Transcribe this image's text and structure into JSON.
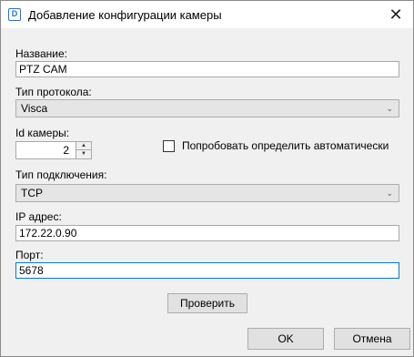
{
  "window": {
    "title": "Добавление конфигурации камеры",
    "app_icon_letter": "D",
    "close_glyph": "✕"
  },
  "form": {
    "name_label": "Название:",
    "name_value": "PTZ CAM",
    "protocol_label": "Тип протокола:",
    "protocol_value": "Visca",
    "camera_id_label": "Id камеры:",
    "camera_id_value": "2",
    "auto_detect_label": "Попробовать определить автоматически",
    "auto_detect_checked": false,
    "connection_label": "Тип подключения:",
    "connection_value": "TCP",
    "ip_label": "IP адрес:",
    "ip_value": "172.22.0.90",
    "port_label": "Порт:",
    "port_value": "5678"
  },
  "buttons": {
    "check_label": "Проверить",
    "ok_label": "OK",
    "cancel_label": "Отмена"
  }
}
